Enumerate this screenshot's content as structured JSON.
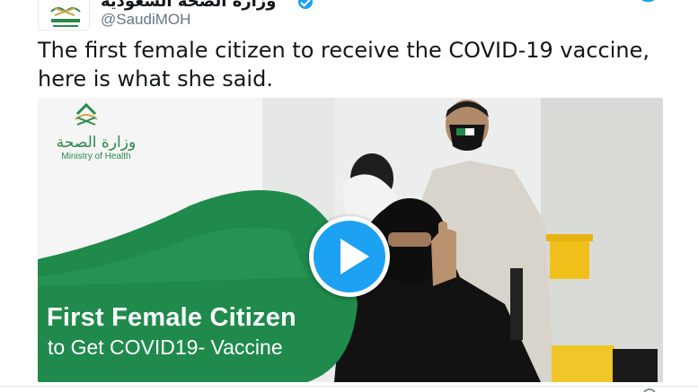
{
  "account": {
    "display_name": "وزارة الصحة السعودية",
    "handle": "@SaudiMOH",
    "avatar_icon": "moh-logo-icon",
    "verified_icon": "verified-badge-icon"
  },
  "tweet": {
    "text": "The first female citizen to receive the COVID-19 vaccine, here is what she said."
  },
  "media": {
    "logo_arabic": "وزارة الصحة",
    "logo_english": "Ministry of Health",
    "banner_title": "First Female Citizen",
    "banner_subtitle": "to Get COVID19- Vaccine",
    "play_icon": "play-icon"
  },
  "colors": {
    "twitter_blue": "#1da1f2",
    "moh_green": "#2a8a4a",
    "banner_green": "#1f8a4c"
  }
}
